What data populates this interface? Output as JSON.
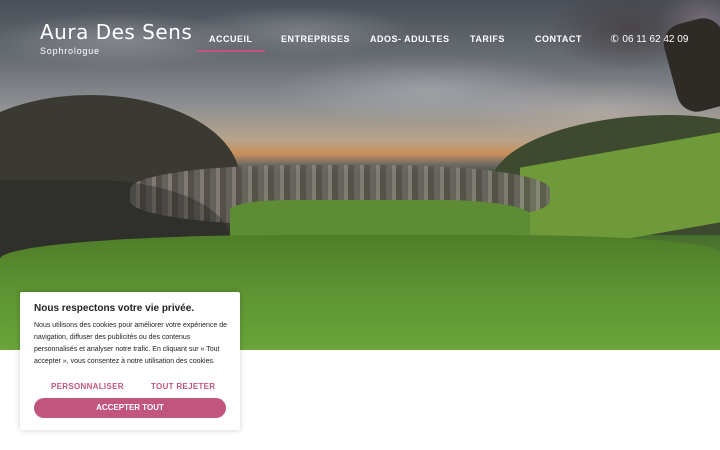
{
  "brand": {
    "name": "Aura Des Sens",
    "tagline": "Sophrologue"
  },
  "nav": {
    "items": [
      {
        "label": "ACCUEIL",
        "active": true
      },
      {
        "label": "ENTREPRISES"
      },
      {
        "label": "ADOS- ADULTES"
      },
      {
        "label": "TARIFS"
      },
      {
        "label": "CONTACT"
      }
    ],
    "phone": "06 11 62 42 09",
    "accent": "#c2557e"
  },
  "cookie": {
    "title": "Nous respectons votre vie privée.",
    "text": "Nous utilisons des cookies pour améliorer votre expérience de navigation, diffuser des publicités ou des contenus personnalisés et analyser notre trafic. En cliquant sur « Tout accepter », vous consentez à notre utilisation des cookies.",
    "customize": "PERSONNALISER",
    "reject": "TOUT REJETER",
    "accept": "ACCEPTER TOUT"
  }
}
